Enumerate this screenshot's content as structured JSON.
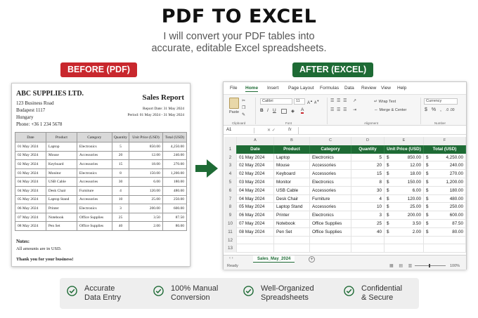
{
  "title": "PDF TO EXCEL",
  "subtitle_line1": "I will convert your PDF tables into",
  "subtitle_line2": "accurate, editable Excel spreadsheets.",
  "badges": {
    "before": "BEFORE (PDF)",
    "after": "AFTER (EXCEL)"
  },
  "colors": {
    "before_badge": "#c8272d",
    "after_badge": "#1e6b35",
    "arrow": "#1e6b35"
  },
  "pdf": {
    "company": "ABC SUPPLIES LTD.",
    "address": [
      "123 Business Road",
      "Budapest 1117",
      "Hungary",
      "Phone: +36 1 234 5678"
    ],
    "report_title": "Sales Report",
    "report_date": "Report Date: 31 May 2024",
    "period": "Period: 01 May 2024 - 31 May 2024",
    "columns": [
      "Date",
      "Product",
      "Category",
      "Quantity",
      "Unit Price (USD)",
      "Total (USD)"
    ],
    "rows": [
      [
        "01 May 2024",
        "Laptop",
        "Electronics",
        "5",
        "850.00",
        "4,250.00"
      ],
      [
        "02 May 2024",
        "Mouse",
        "Accessories",
        "20",
        "12.00",
        "240.00"
      ],
      [
        "02 May 2024",
        "Keyboard",
        "Accessories",
        "15",
        "18.00",
        "270.00"
      ],
      [
        "03 May 2024",
        "Monitor",
        "Electronics",
        "8",
        "150.00",
        "1,200.00"
      ],
      [
        "04 May 2024",
        "USB Cable",
        "Accessories",
        "30",
        "6.00",
        "180.00"
      ],
      [
        "04 May 2024",
        "Desk Chair",
        "Furniture",
        "4",
        "120.00",
        "480.00"
      ],
      [
        "05 May 2024",
        "Laptop Stand",
        "Accessories",
        "10",
        "25.00",
        "250.00"
      ],
      [
        "06 May 2024",
        "Printer",
        "Electronics",
        "3",
        "200.00",
        "600.00"
      ],
      [
        "07 May 2024",
        "Notebook",
        "Office Supplies",
        "25",
        "3.50",
        "87.50"
      ],
      [
        "08 May 2024",
        "Pen Set",
        "Office Supplies",
        "40",
        "2.00",
        "80.00"
      ]
    ],
    "notes_heading": "Notes:",
    "notes": "All amounts are in USD.",
    "thanks": "Thank you for your business!"
  },
  "excel": {
    "menu": [
      "File",
      "Home",
      "Insert",
      "Page Layout",
      "Formulas",
      "Data",
      "Review",
      "View",
      "Help"
    ],
    "active_menu": "Home",
    "ribbon": {
      "paste": "Paste",
      "font_name": "Calibri",
      "font_size": "11",
      "wrap_text": "Wrap Text",
      "merge_center": "Merge & Center",
      "number_format": "Currency",
      "groups": [
        "Clipboard",
        "Font",
        "Alignment",
        "Number"
      ]
    },
    "name_box": "A1",
    "fx": "fx",
    "col_letters": [
      "A",
      "B",
      "C",
      "D",
      "E",
      "F"
    ],
    "headers": [
      "Date",
      "Product",
      "Category",
      "Quantity",
      "Unit Price (USD)",
      "Total (USD)"
    ],
    "rows": [
      [
        "01 May 2024",
        "Laptop",
        "Electronics",
        "5",
        "$",
        "850.00",
        "$",
        "4,250.00"
      ],
      [
        "02 May 2024",
        "Mouse",
        "Accessories",
        "20",
        "$",
        "12.00",
        "$",
        "240.00"
      ],
      [
        "02 May 2024",
        "Keyboard",
        "Accessories",
        "15",
        "$",
        "18.00",
        "$",
        "270.00"
      ],
      [
        "03 May 2024",
        "Monitor",
        "Electronics",
        "8",
        "$",
        "150.00",
        "$",
        "1,200.00"
      ],
      [
        "04 May 2024",
        "USB Cable",
        "Accessories",
        "30",
        "$",
        "6.00",
        "$",
        "180.00"
      ],
      [
        "04 May 2024",
        "Desk Chair",
        "Furniture",
        "4",
        "$",
        "120.00",
        "$",
        "480.00"
      ],
      [
        "05 May 2024",
        "Laptop Stand",
        "Accessories",
        "10",
        "$",
        "25.00",
        "$",
        "250.00"
      ],
      [
        "06 May 2024",
        "Printer",
        "Electronics",
        "3",
        "$",
        "200.00",
        "$",
        "600.00"
      ],
      [
        "07 May 2024",
        "Notebook",
        "Office Supplies",
        "25",
        "$",
        "3.50",
        "$",
        "87.50"
      ],
      [
        "08 May 2024",
        "Pen Set",
        "Office Supplies",
        "40",
        "$",
        "2.00",
        "$",
        "80.00"
      ]
    ],
    "row_numbers": [
      "1",
      "2",
      "3",
      "4",
      "5",
      "6",
      "7",
      "8",
      "9",
      "10",
      "11",
      "12",
      "13"
    ],
    "sheet_tab": "Sales_May_2024",
    "status": "Ready",
    "zoom": "100%"
  },
  "features": [
    {
      "label": "Accurate\nData Entry"
    },
    {
      "label": "100% Manual\nConversion"
    },
    {
      "label": "Well-Organized\nSpreadsheets"
    },
    {
      "label": "Confidential\n& Secure"
    }
  ]
}
